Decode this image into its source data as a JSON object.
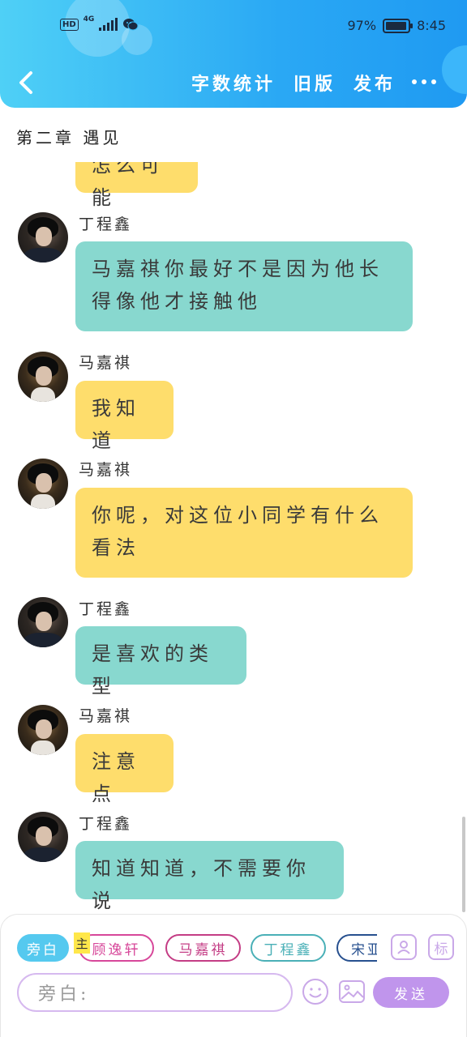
{
  "status_bar": {
    "hd": "HD",
    "network": "4G",
    "battery_text": "97%",
    "battery_level": 0.97,
    "time": "8:45"
  },
  "header": {
    "back_icon": "chevron-left-icon",
    "actions": [
      "字数统计",
      "旧版",
      "发布"
    ],
    "more_icon": "more-dots-icon",
    "colors": {
      "gradient_start": "#4fd0f6",
      "gradient_end": "#1f9af2"
    }
  },
  "chapter": {
    "title": "第二章 遇见"
  },
  "messages": [
    {
      "sender": "",
      "text": "怎么可能",
      "color": "yellow",
      "partial": true
    },
    {
      "sender": "丁程鑫",
      "text": "马嘉祺你最好不是因为他长得像他才接触他",
      "color": "teal"
    },
    {
      "sender": "马嘉祺",
      "text": "我知道",
      "color": "yellow"
    },
    {
      "sender": "马嘉祺",
      "text": "你呢，对这位小同学有什么看法",
      "color": "yellow"
    },
    {
      "sender": "丁程鑫",
      "text": "是喜欢的类型",
      "color": "teal"
    },
    {
      "sender": "马嘉祺",
      "text": "注意点",
      "color": "yellow"
    },
    {
      "sender": "丁程鑫",
      "text": "知道知道，不需要你说",
      "color": "teal"
    }
  ],
  "bubble_colors": {
    "teal": "#88d8cf",
    "yellow": "#fedd6c"
  },
  "composer": {
    "chips": [
      "旁白",
      "顾逸轩",
      "马嘉祺",
      "丁程鑫",
      "宋亚"
    ],
    "main_tag": "主",
    "side_buttons": [
      "person-card-icon",
      "标"
    ],
    "input_placeholder": "旁白:",
    "emoji_icon": "smiley-icon",
    "image_icon": "image-icon",
    "send_label": "发送"
  }
}
